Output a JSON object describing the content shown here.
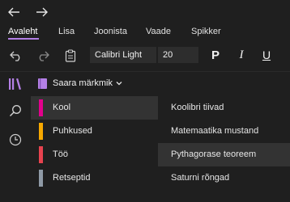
{
  "nav": {
    "back_icon": "arrow-left-icon",
    "forward_icon": "arrow-right-icon"
  },
  "tabs": [
    {
      "label": "Avaleht",
      "active": true
    },
    {
      "label": "Lisa",
      "active": false
    },
    {
      "label": "Joonista",
      "active": false
    },
    {
      "label": "Vaade",
      "active": false
    },
    {
      "label": "Spikker",
      "active": false
    }
  ],
  "toolbar": {
    "undo_icon": "undo-icon",
    "redo_icon": "redo-icon",
    "clipboard_icon": "clipboard-icon",
    "font_name": "Calibri Light",
    "font_size": "20",
    "bold_label": "P",
    "italic_label": "I",
    "underline_label": "U"
  },
  "rail": {
    "notebooks_icon": "notebooks-icon",
    "search_icon": "search-icon",
    "recent_icon": "clock-icon"
  },
  "notebook": {
    "title": "Saara märkmik",
    "icon": "notebook-icon",
    "color": "#b480e6"
  },
  "sections": [
    {
      "label": "Kool",
      "color": "#e3008c",
      "selected": true
    },
    {
      "label": "Puhkused",
      "color": "#f6a800",
      "selected": false
    },
    {
      "label": "Töö",
      "color": "#e8434f",
      "selected": false
    },
    {
      "label": "Retseptid",
      "color": "#8f9aa6",
      "selected": false
    }
  ],
  "pages": [
    {
      "label": "Koolibri tiivad",
      "selected": false
    },
    {
      "label": "Matemaatika mustand",
      "selected": false
    },
    {
      "label": "Pythagorase teoreem",
      "selected": true
    },
    {
      "label": "Saturni rõngad",
      "selected": false
    }
  ],
  "colors": {
    "accent": "#b480e6",
    "background": "#1f1f1f",
    "selected": "#333333"
  }
}
